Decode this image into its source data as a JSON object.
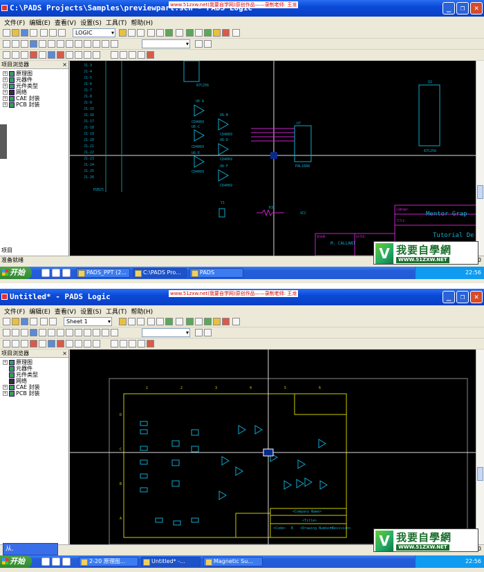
{
  "top_window": {
    "title": "C:\\PADS Projects\\Samples\\previewpart.sch - PADS Logic",
    "watermark": "www.51zxw.net(我要自学网)原创作品——录制老师: 王龙",
    "menu": [
      "文件(F)",
      "编辑(E)",
      "查看(V)",
      "设置(S)",
      "工具(T)",
      "帮助(H)"
    ],
    "combo_value": "LOGIC",
    "sidebar_title": "项目浏览器",
    "tree": [
      "原理图",
      "元器件",
      "元件类型",
      "网络",
      "CAE 封装",
      "PCB 封装"
    ],
    "sidebar_tab": "项目",
    "status_left": "准备就绪",
    "status_right": "宽度",
    "status_coord": "600",
    "schematic": {
      "refs": [
        "U6-A",
        "U6-B",
        "U6-C",
        "U6-D",
        "U6-E",
        "U6-F",
        "U7",
        "U2",
        "Y1",
        "R3"
      ],
      "parts": [
        "87C256",
        "CD4069",
        "CD4069",
        "CD4069",
        "CD4069",
        "CD4069",
        "CD4069",
        "PAL16R8",
        "87C256",
        "VCC"
      ],
      "pins": [
        "J1-3",
        "J1-4",
        "J1-5",
        "J1-6",
        "J1-7",
        "J1-8",
        "J1-9",
        "J1-15",
        "J1-16",
        "J1-17",
        "J1-18",
        "J1-19",
        "J1-20",
        "J1-21",
        "J1-22",
        "J1-23",
        "J1-24",
        "J1-25",
        "J1-26"
      ],
      "conn_label": "DSB25",
      "company_label": "COMPANY:",
      "company": "Mentor Grap",
      "title_label": "TITLE:",
      "title": "Tutorial De",
      "drawn_label": "DRAWN:",
      "drawn": "M. CALLANT",
      "dated_label": "DATED:"
    },
    "taskbar": {
      "start": "开始",
      "tasks": [
        "PADS_PPT (2...",
        "C:\\PADS Pro...",
        "PADS"
      ],
      "clock": "22:56"
    }
  },
  "bottom_window": {
    "title": "Untitled* - PADS Logic",
    "watermark": "www.51zxw.net(我要自学网)原创作品——录制老师: 王龙",
    "menu": [
      "文件(F)",
      "编辑(E)",
      "查看(V)",
      "设置(S)",
      "工具(T)",
      "帮助(H)"
    ],
    "combo_value": "Sheet 1",
    "sidebar_title": "项目浏览器",
    "tree": [
      "原理图",
      "元器件",
      "元件类型",
      "网络",
      "CAE 封装",
      "PCB 封装"
    ],
    "status_right": "宽度",
    "status_coord": "5700",
    "sheet": {
      "col_labels": [
        "1",
        "2",
        "3",
        "4",
        "5",
        "6"
      ],
      "row_labels": [
        "D",
        "C",
        "B",
        "A"
      ],
      "company_name": "<Company Name>",
      "title": "<Title>",
      "code": "<Code>",
      "size": "B",
      "drawing_number": "<Drawing Number>",
      "revision": "<Revision>"
    },
    "taskbar": {
      "start": "开始",
      "ime": "从.",
      "tasks": [
        "2-20 原理图...",
        "Untitled* -...",
        "Magnetic Su..."
      ],
      "clock": "22:56"
    }
  },
  "logo": {
    "mark": "V",
    "text": "我要自學網",
    "url": "WWW.51ZXW.NET"
  }
}
